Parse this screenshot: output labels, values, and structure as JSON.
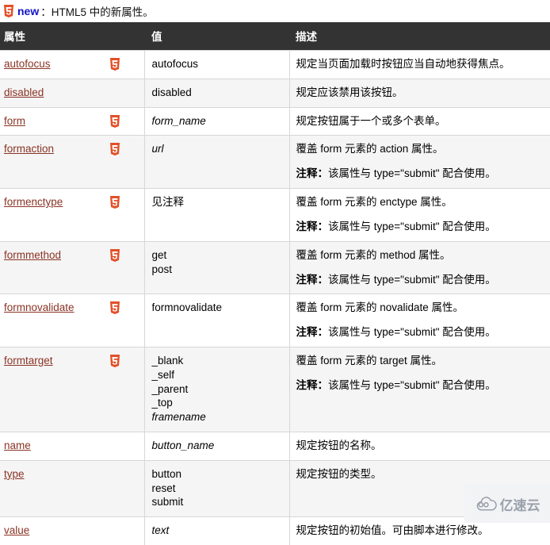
{
  "legend": {
    "badge_icon": "html5-badge-icon",
    "new_label": "new",
    "separator": "：",
    "text": "HTML5 中的新属性。"
  },
  "table": {
    "columns": [
      "属性",
      "值",
      "描述"
    ],
    "rows": [
      {
        "attribute": "autofocus",
        "html5": true,
        "value": "autofocus",
        "value_italic": false,
        "desc": "规定当页面加载时按钮应当自动地获得焦点。",
        "note_label": "",
        "note": ""
      },
      {
        "attribute": "disabled",
        "html5": false,
        "value": "disabled",
        "value_italic": false,
        "desc": "规定应该禁用该按钮。",
        "note_label": "",
        "note": ""
      },
      {
        "attribute": "form",
        "html5": true,
        "value": "form_name",
        "value_italic": true,
        "desc": "规定按钮属于一个或多个表单。",
        "note_label": "",
        "note": ""
      },
      {
        "attribute": "formaction",
        "html5": true,
        "value": "url",
        "value_italic": true,
        "desc": "覆盖 form 元素的 action 属性。",
        "note_label": "注释：",
        "note": "该属性与 type=\"submit\" 配合使用。"
      },
      {
        "attribute": "formenctype",
        "html5": true,
        "value": "见注释",
        "value_italic": false,
        "desc": "覆盖 form 元素的 enctype 属性。",
        "note_label": "注释：",
        "note": "该属性与 type=\"submit\" 配合使用。"
      },
      {
        "attribute": "formmethod",
        "html5": true,
        "value": "get\npost",
        "value_italic": false,
        "desc": "覆盖 form 元素的 method 属性。",
        "note_label": "注释：",
        "note": "该属性与 type=\"submit\" 配合使用。"
      },
      {
        "attribute": "formnovalidate",
        "html5": true,
        "value": "formnovalidate",
        "value_italic": false,
        "desc": "覆盖 form 元素的 novalidate 属性。",
        "note_label": "注释：",
        "note": "该属性与 type=\"submit\" 配合使用。"
      },
      {
        "attribute": "formtarget",
        "html5": true,
        "value": "_blank\n_self\n_parent\n_top",
        "value_extra_italic": "framename",
        "value_italic": false,
        "desc": "覆盖 form 元素的 target 属性。",
        "note_label": "注释：",
        "note": "该属性与 type=\"submit\" 配合使用。"
      },
      {
        "attribute": "name",
        "html5": false,
        "value": "button_name",
        "value_italic": true,
        "desc": "规定按钮的名称。",
        "note_label": "",
        "note": ""
      },
      {
        "attribute": "type",
        "html5": false,
        "value": "button\nreset\nsubmit",
        "value_italic": false,
        "desc": "规定按钮的类型。",
        "note_label": "",
        "note": ""
      },
      {
        "attribute": "value",
        "html5": false,
        "value": "text",
        "value_italic": true,
        "desc": "规定按钮的初始值。可由脚本进行修改。",
        "note_label": "",
        "note": ""
      }
    ]
  },
  "watermark": {
    "icon": "cloud-logo-icon",
    "text": "亿速云"
  },
  "colors": {
    "header_bg": "#333333",
    "link": "#8a3324",
    "new_label": "#1414c8",
    "html5_badge": "#e34f26",
    "row_alt_bg": "#f5f5f5",
    "border": "#d7d7d7",
    "watermark_text": "#9aa1ab"
  }
}
